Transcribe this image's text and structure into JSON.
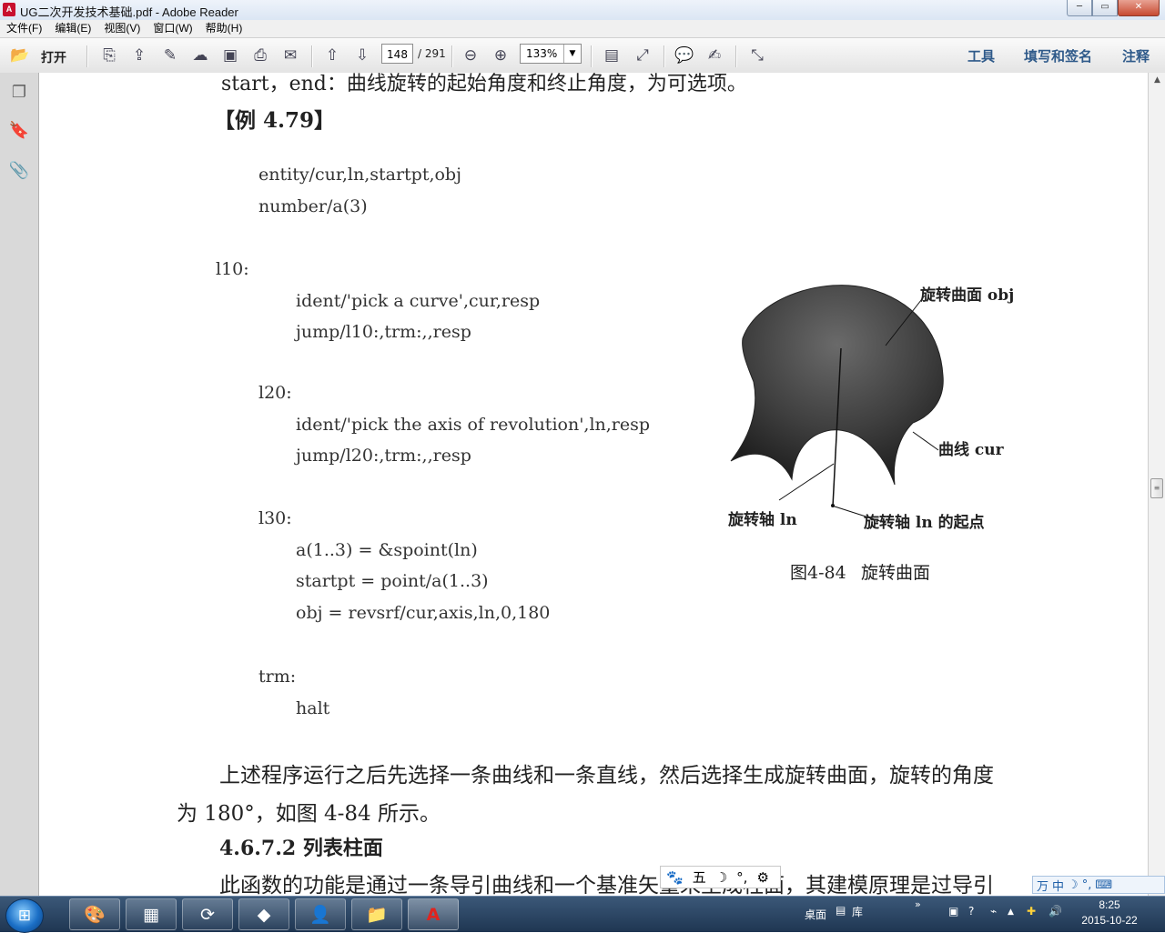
{
  "window": {
    "title": "UG二次开发技术基础.pdf - Adobe Reader",
    "min_label": "─",
    "max_label": "▭",
    "close_label": "✕"
  },
  "menu": [
    "文件(F)",
    "编辑(E)",
    "视图(V)",
    "窗口(W)",
    "帮助(H)"
  ],
  "toolbar": {
    "open_label": "打开",
    "page_current": "148",
    "page_total": "/ 291",
    "zoom": "133%",
    "links": [
      "工具",
      "填写和签名",
      "注释"
    ]
  },
  "document": {
    "top_line": "start，end：曲线旋转的起始角度和终止角度，为可选项。",
    "example_heading": "【例 4.79】",
    "code": [
      "entity/cur,ln,startpt,obj",
      "number/a(3)",
      "l10:",
      "ident/'pick a curve',cur,resp",
      "jump/l10:,trm:,,resp",
      "l20:",
      "ident/'pick the axis of revolution',ln,resp",
      "jump/l20:,trm:,,resp",
      "l30:",
      "a(1..3) = &spoint(ln)",
      "startpt = point/a(1..3)",
      "obj = revsrf/cur,axis,ln,0,180",
      "trm:",
      "halt"
    ],
    "figure": {
      "label_surface": "旋转曲面 obj",
      "label_curve": "曲线 cur",
      "label_axis": "旋转轴 ln",
      "label_start": "旋转轴 ln 的起点",
      "caption_num": "图4-84",
      "caption_text": "旋转曲面"
    },
    "paragraph_line1": "上述程序运行之后先选择一条曲线和一条直线，然后选择生成旋转曲面，旋转的角度",
    "paragraph_line2": "为 180°，如图 4-84 所示。",
    "section_heading": "4.6.7.2   列表柱面",
    "bottom_line": "此函数的功能是通过一条导引曲线和一个基准矢量来生成柱面，其建模原理是过导引"
  },
  "ime": {
    "items": [
      "五",
      "☽",
      "°,",
      "⚙"
    ],
    "bar2": [
      "中",
      "☽",
      "°,",
      "⌨"
    ]
  },
  "taskbar": {
    "desktop_label": "桌面",
    "library_label": "库",
    "time": "8:25",
    "date": "2015-10-22"
  }
}
